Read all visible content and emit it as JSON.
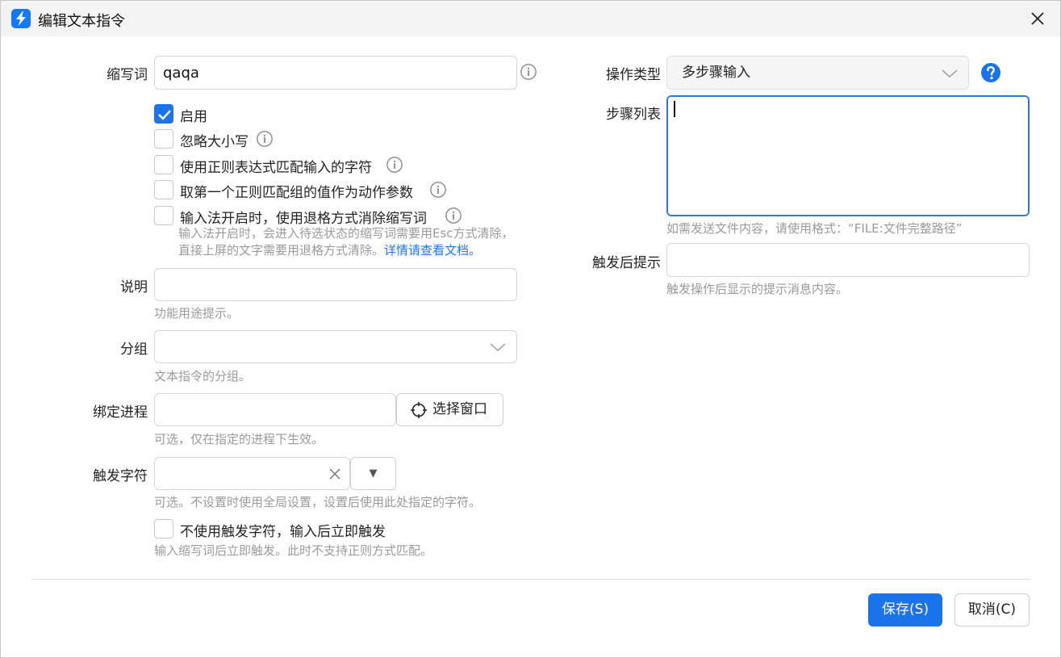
{
  "window": {
    "title": "编辑文本指令"
  },
  "abbr": {
    "label": "缩写词",
    "value": "qaqa"
  },
  "checkboxes": [
    {
      "label": "启用",
      "checked": true
    },
    {
      "label": "忽略大小写",
      "checked": false
    },
    {
      "label": "使用正则表达式匹配输入的字符",
      "checked": false
    },
    {
      "label": "取第一个正则匹配组的值作为动作参数",
      "checked": false
    },
    {
      "label": "输入法开启时，使用退格方式消除缩写词",
      "checked": false
    }
  ],
  "ime_hint": {
    "line1": "输入法开启时，会进入待选状态的缩写词需要用Esc方式清除，",
    "line2": "直接上屏的文字需要用退格方式清除。",
    "link": "详情请查看文档。"
  },
  "description": {
    "label": "说明",
    "value": "",
    "hint": "功能用途提示。"
  },
  "group": {
    "label": "分组",
    "value": "",
    "hint": "文本指令的分组。"
  },
  "process": {
    "label": "绑定进程",
    "value": "",
    "button": "选择窗口",
    "hint": "可选，仅在指定的进程下生效。"
  },
  "trigger_char": {
    "label": "触发字符",
    "value": "",
    "dropdown": "▼",
    "hint": "可选。不设置时使用全局设置，设置后使用此处指定的字符。"
  },
  "instant": {
    "label": "不使用触发字符，输入后立即触发",
    "checked": false,
    "hint": "输入缩写词后立即触发。此时不支持正则方式匹配。"
  },
  "op_type": {
    "label": "操作类型",
    "value": "多步骤输入"
  },
  "steps": {
    "label": "步骤列表",
    "value": "",
    "hint": "如需发送文件内容，请使用格式：“FILE:文件完整路径”"
  },
  "after_tip": {
    "label": "触发后提示",
    "value": "",
    "hint": "触发操作后显示的提示消息内容。"
  },
  "footer": {
    "save": "保存(S)",
    "cancel": "取消(C)"
  },
  "colors": {
    "accent": "#1a73e8",
    "link": "#1677ff"
  }
}
